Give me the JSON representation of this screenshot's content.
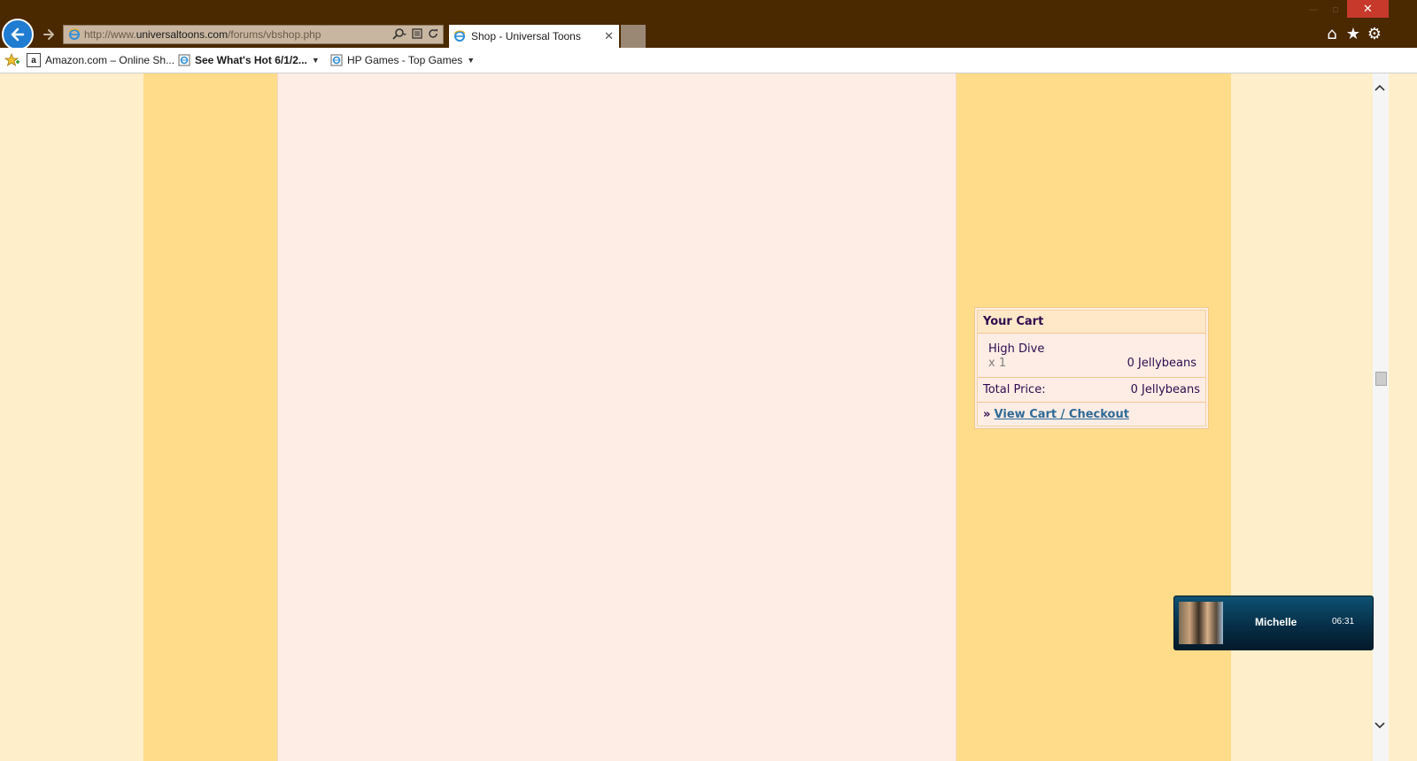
{
  "browser": {
    "address": {
      "prefix": "http://www.",
      "domain": "universaltoons.com",
      "path": "/forums/vbshop.php"
    },
    "tab": {
      "title": "Shop - Universal Toons",
      "close": "✕"
    },
    "window": {
      "close": "✕",
      "minimize": "—",
      "maximize": "▫"
    },
    "toolbar": {
      "home": "⌂",
      "favorites": "★",
      "tools": "⚙"
    },
    "favorites": [
      {
        "label": "Amazon.com – Online Sh...",
        "icon": "a",
        "dropdown": false
      },
      {
        "label": "See What's Hot 6/1/2...",
        "icon": "ie",
        "dropdown": true
      },
      {
        "label": "HP Games - Top Games",
        "icon": "ie",
        "dropdown": true
      }
    ]
  },
  "cart": {
    "title": "Your Cart",
    "item": {
      "name": "High Dive",
      "qty": "x 1",
      "price": "0 Jellybeans"
    },
    "total_label": "Total Price:",
    "total_value": "0 Jellybeans",
    "link_arrow": "»",
    "link_label": "View Cart / Checkout"
  },
  "player": {
    "name": "Michelle",
    "time": "06:31"
  },
  "colors": {
    "titlebar": "#4A2800",
    "page_bg": "#FEEEC9",
    "side_col": "#FEDC8A",
    "center_col": "#FEEDE5",
    "link": "#2E6A96",
    "text": "#2E0B4E"
  }
}
